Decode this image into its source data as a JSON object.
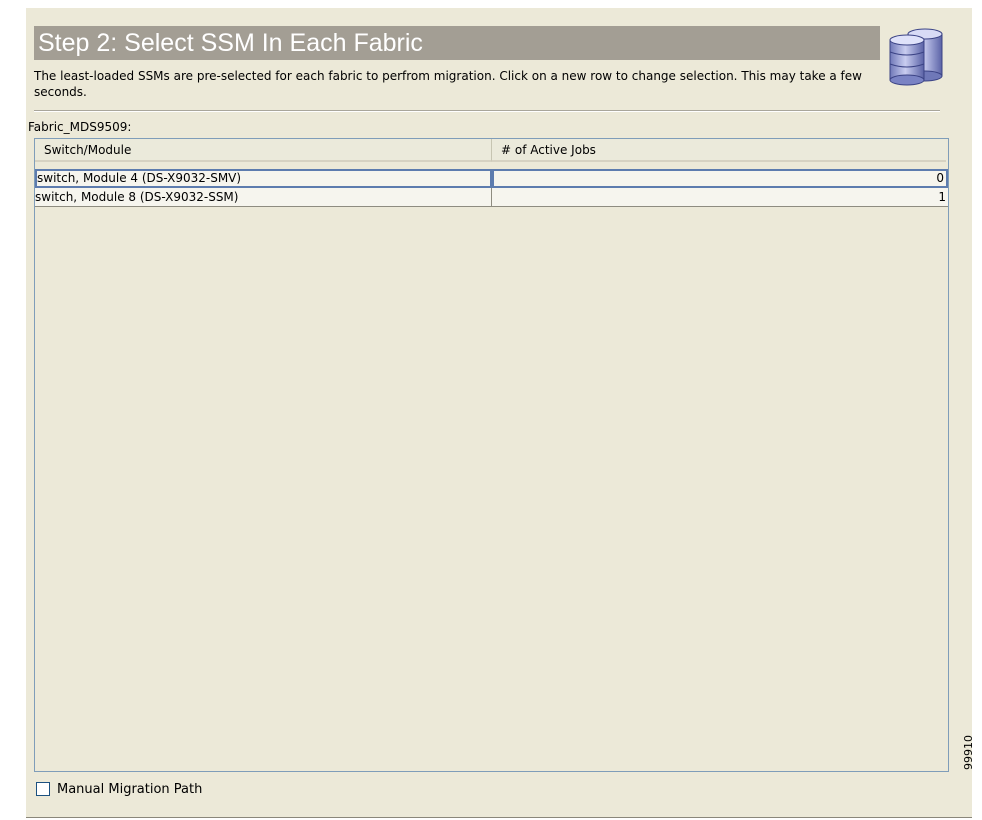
{
  "wizard": {
    "title": "Step 2: Select SSM In Each Fabric",
    "description": "The least-loaded SSMs are pre-selected for each fabric to perfrom migration. Click on a new row to change selection. This may take a few seconds.",
    "header_icon": "database-icon"
  },
  "fabric": {
    "label": "Fabric_MDS9509:"
  },
  "table": {
    "columns": [
      "Switch/Module",
      "# of Active Jobs"
    ],
    "rows": [
      {
        "module": "switch, Module 4 (DS-X9032-SMV)",
        "jobs": "0",
        "selected": true
      },
      {
        "module": "switch, Module 8 (DS-X9032-SSM)",
        "jobs": "1",
        "selected": false
      }
    ]
  },
  "options": {
    "manual_migration_label": "Manual Migration Path",
    "manual_migration_checked": false
  },
  "figure_id": "99910"
}
